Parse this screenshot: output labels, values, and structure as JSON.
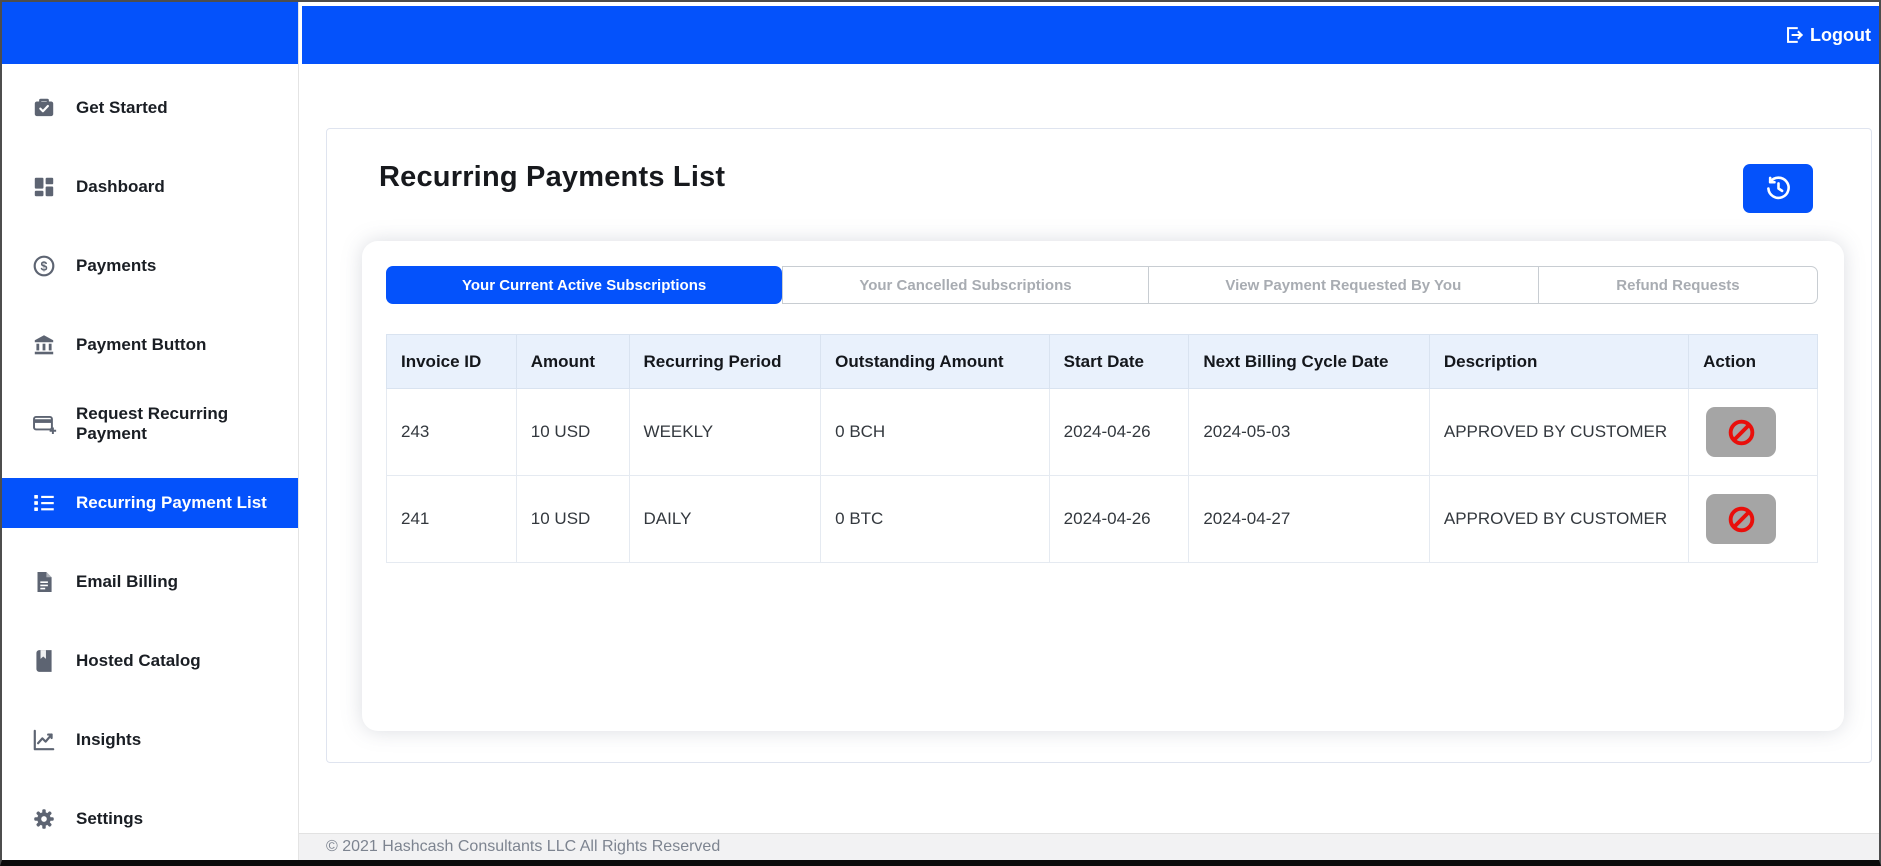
{
  "colors": {
    "primary": "#0452fb",
    "table_header_bg": "#e9f1fc",
    "ban_red": "#e90f0b",
    "action_button_gray": "#a5a5a5",
    "sidebar_icon_gray": "#5d6472"
  },
  "topbar": {
    "logout_label": "Logout",
    "logout_icon": "logout-icon"
  },
  "sidebar": {
    "items": [
      {
        "label": "Get Started",
        "icon": "briefcase-check-icon",
        "active": false
      },
      {
        "label": "Dashboard",
        "icon": "dashboard-grid-icon",
        "active": false
      },
      {
        "label": "Payments",
        "icon": "dollar-circle-icon",
        "active": false
      },
      {
        "label": "Payment Button",
        "icon": "bank-icon",
        "active": false
      },
      {
        "label": "Request Recurring Payment",
        "icon": "card-plus-icon",
        "active": false
      },
      {
        "label": "Recurring Payment List",
        "icon": "list-icon",
        "active": true
      },
      {
        "label": "Email Billing",
        "icon": "document-icon",
        "active": false
      },
      {
        "label": "Hosted Catalog",
        "icon": "book-icon",
        "active": false
      },
      {
        "label": "Insights",
        "icon": "chart-line-icon",
        "active": false
      },
      {
        "label": "Settings",
        "icon": "gear-icon",
        "active": false
      }
    ]
  },
  "main": {
    "title": "Recurring Payments List",
    "refresh_icon": "history-icon",
    "tabs": [
      {
        "label": "Your Current Active Subscriptions",
        "active": true
      },
      {
        "label": "Your Cancelled Subscriptions",
        "active": false
      },
      {
        "label": "View Payment Requested By You",
        "active": false
      },
      {
        "label": "Refund Requests",
        "active": false
      }
    ],
    "table": {
      "headers": [
        "Invoice ID",
        "Amount",
        "Recurring Period",
        "Outstanding Amount",
        "Start Date",
        "Next Billing Cycle Date",
        "Description",
        "Action"
      ],
      "rows": [
        {
          "invoice_id": "243",
          "amount": "10 USD",
          "recurring_period": "WEEKLY",
          "outstanding_amount": "0 BCH",
          "start_date": "2024-04-26",
          "next_billing_cycle_date": "2024-05-03",
          "description": "APPROVED BY CUSTOMER",
          "action_icon": "ban-icon"
        },
        {
          "invoice_id": "241",
          "amount": "10 USD",
          "recurring_period": "DAILY",
          "outstanding_amount": "0 BTC",
          "start_date": "2024-04-26",
          "next_billing_cycle_date": "2024-04-27",
          "description": "APPROVED BY CUSTOMER",
          "action_icon": "ban-icon"
        }
      ]
    }
  },
  "footer": {
    "copyright": "© 2021 Hashcash Consultants LLC All Rights Reserved"
  }
}
